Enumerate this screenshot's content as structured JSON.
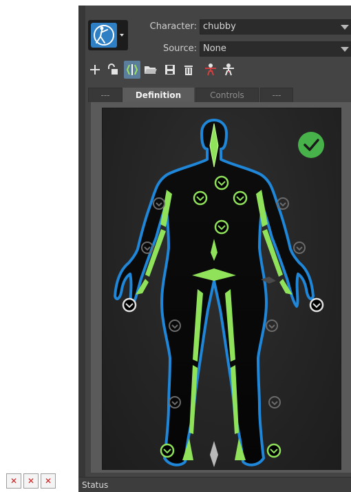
{
  "character": {
    "label": "Character:",
    "value": "chubby"
  },
  "source": {
    "label": "Source:",
    "value": "None"
  },
  "toolbar": {
    "icons": [
      "plus-icon",
      "unlock-icon",
      "mirror-icon",
      "open-folder-icon",
      "save-icon",
      "delete-icon",
      "skeleton-icon",
      "character-icon"
    ]
  },
  "tabs": [
    {
      "label": "---",
      "active": false
    },
    {
      "label": "Definition",
      "active": true
    },
    {
      "label": "Controls",
      "active": false
    },
    {
      "label": "---",
      "active": false
    }
  ],
  "definition": {
    "valid": true,
    "status_color": "#47b24a",
    "bone_color": "#8fe25a",
    "outline_color": "#2a8ad6"
  },
  "status": {
    "label": "Status"
  },
  "broken_images": {
    "count": 3
  }
}
